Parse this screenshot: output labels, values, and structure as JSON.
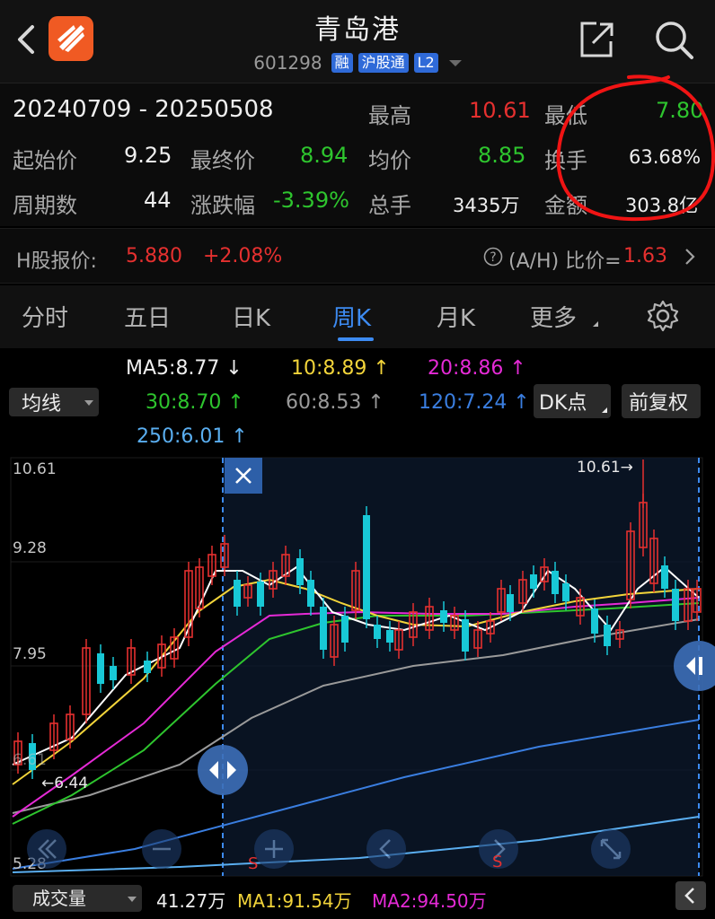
{
  "header": {
    "title": "青岛港",
    "code": "601298",
    "tags": [
      "融",
      "沪股通",
      "L2"
    ]
  },
  "stats": {
    "date_range": "20240709  -  20250508",
    "high_label": "最高",
    "high_value": "10.61",
    "low_label": "最低",
    "low_value": "7.80",
    "open_label": "起始价",
    "open_value": "9.25",
    "close_label": "最终价",
    "close_value": "8.94",
    "avg_label": "均价",
    "avg_value": "8.85",
    "turnover_label": "换手",
    "turnover_value": "63.68%",
    "periods_label": "周期数",
    "periods_value": "44",
    "change_label": "涨跌幅",
    "change_value": "-3.39%",
    "volume_label": "总手",
    "volume_value": "3435万",
    "amount_label": "金额",
    "amount_value": "303.8亿"
  },
  "h_share": {
    "label": "H股报价:",
    "price": "5.880",
    "change": "+2.08%",
    "ratio_label": "(A/H) 比价=",
    "ratio_value": "1.63"
  },
  "tabs": [
    {
      "label": "分时",
      "active": false
    },
    {
      "label": "五日",
      "active": false
    },
    {
      "label": "日K",
      "active": false
    },
    {
      "label": "周K",
      "active": true
    },
    {
      "label": "月K",
      "active": false
    },
    {
      "label": "更多",
      "active": false
    }
  ],
  "ma_legend": {
    "ma5": "MA5:8.77",
    "ma10": "10:8.89",
    "ma20": "20:8.86",
    "ma30": "30:8.70",
    "ma60": "60:8.53",
    "ma120": "120:7.24",
    "ma250": "250:6.01",
    "selector": "均线",
    "dk_button": "DK点",
    "adjust_button": "前复权"
  },
  "chart_labels": {
    "y_top": "10.61",
    "y_mid1": "9.28",
    "y_mid2": "7.95",
    "y_bottom": "5.28",
    "y_partial": "6.61",
    "max_marker": "10.61→",
    "min_marker": "←6.44",
    "s_marker": "S"
  },
  "volume": {
    "selector": "成交量",
    "value": "41.27万",
    "ma1": "MA1:91.54万",
    "ma2": "MA2:94.50万"
  },
  "colors": {
    "up": "#e5302f",
    "down": "#18c8d6",
    "accent": "#3d8bf2",
    "ma5": "#ffffff",
    "ma10": "#f2d43a",
    "ma20": "#e52ad6",
    "ma30": "#2ec52e",
    "ma60": "#9a9a9a",
    "ma120": "#3a7ee0",
    "ma250": "#5aaef0"
  },
  "icons": [
    "back-icon",
    "app-logo-icon",
    "share-icon",
    "search-icon",
    "gear-icon",
    "close-icon",
    "help-icon",
    "chevron-right-icon"
  ]
}
